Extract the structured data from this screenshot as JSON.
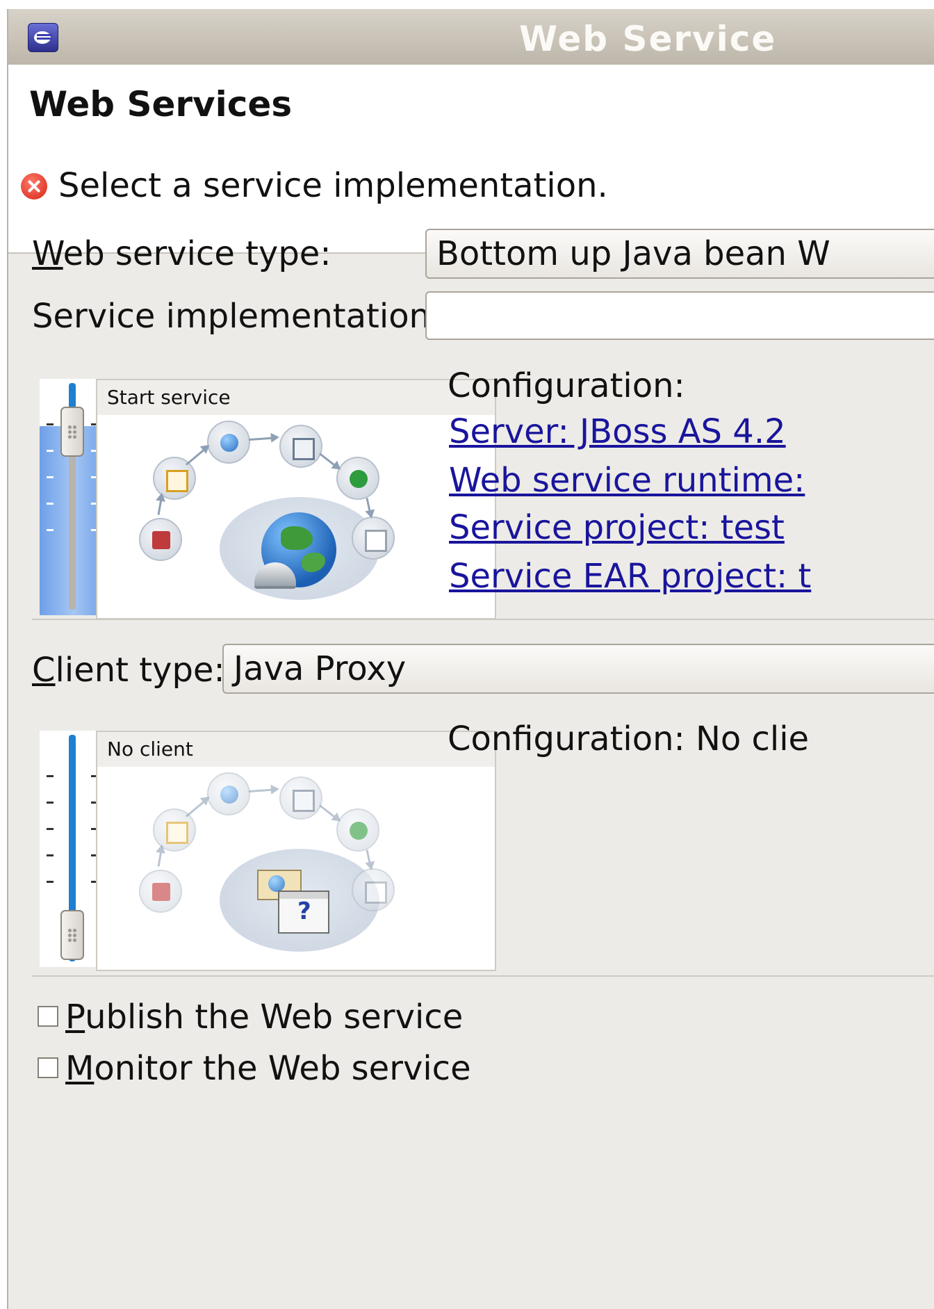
{
  "window": {
    "title": "Web Service"
  },
  "header": {
    "title": "Web Services",
    "message": "Select a service implementation."
  },
  "service": {
    "type_label_prefix": "W",
    "type_label_rest": "eb service type:",
    "type_value": "Bottom up Java bean W",
    "impl_label": "Service implementation:",
    "impl_value": "",
    "panel_label": "Start service",
    "config_label": "Configuration:",
    "links": [
      "Server: JBoss AS 4.2",
      "Web service runtime:",
      "Service project: test",
      "Service EAR project: t"
    ],
    "slider_level_fraction": 1.0
  },
  "client": {
    "type_label_prefix": "C",
    "type_label_rest": "lient type:",
    "type_value": "Java Proxy",
    "panel_label": "No client",
    "config_text": "Configuration: No clie",
    "slider_level_fraction": 0.0
  },
  "options": {
    "publish": {
      "prefix": "P",
      "rest": "ublish the Web service",
      "checked": false
    },
    "monitor": {
      "prefix": "M",
      "rest": "onitor the Web service",
      "checked": false
    }
  },
  "colors": {
    "error": "#d42416",
    "link": "#19159c",
    "slider_fill": "#1f7fd0"
  }
}
